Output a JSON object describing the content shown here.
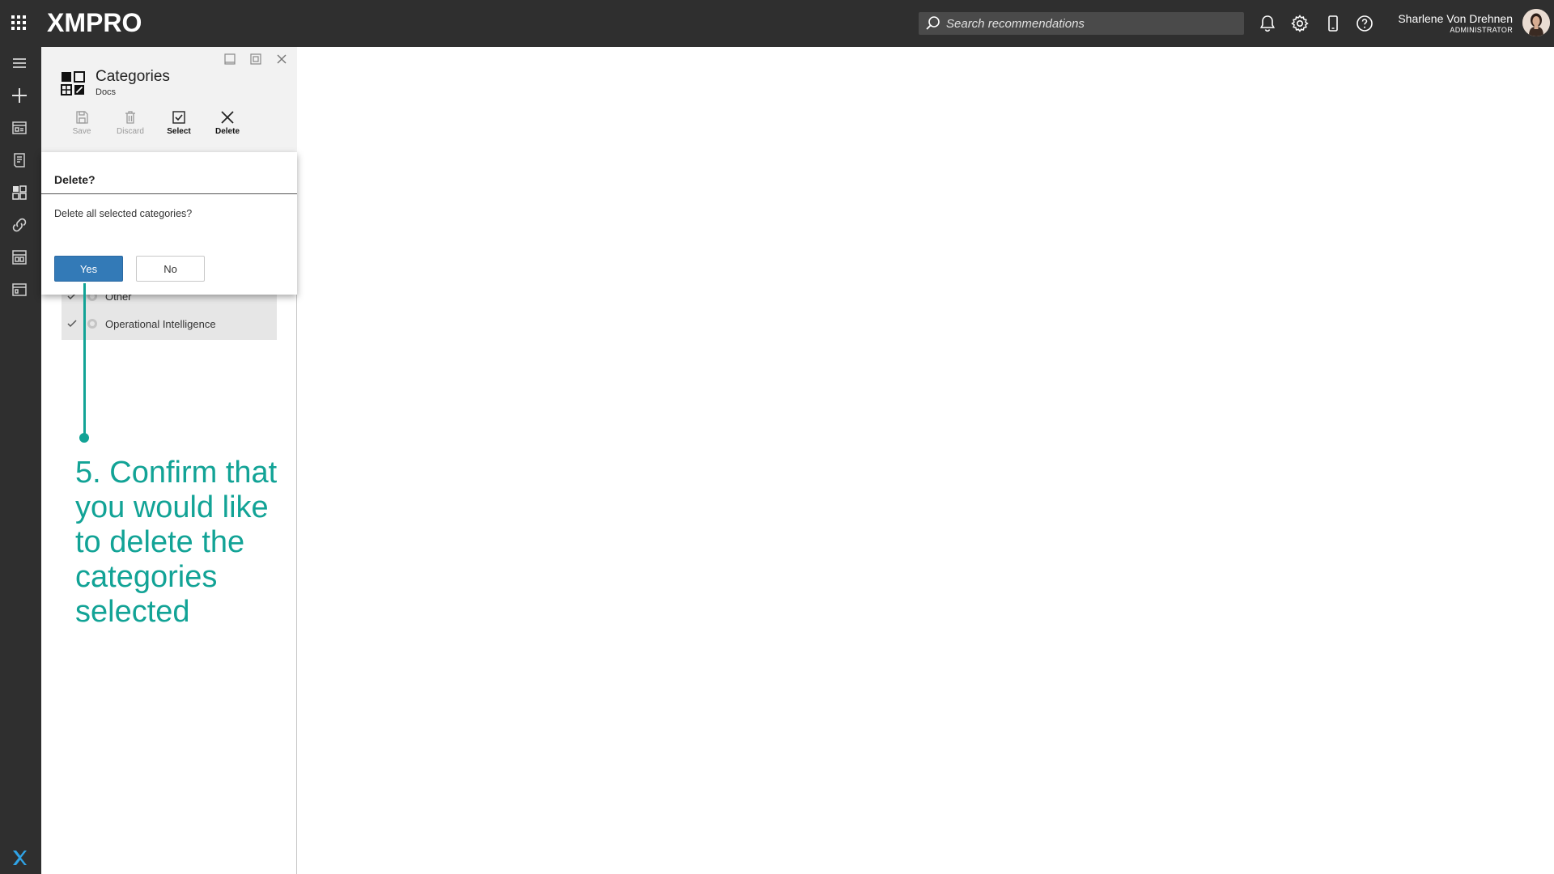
{
  "app": {
    "brand": "XMPRO",
    "search_placeholder": "Search recommendations"
  },
  "user": {
    "name": "Sharlene Von Drehnen",
    "role": "ADMINISTRATOR"
  },
  "panel": {
    "title": "Categories",
    "subtitle": "Docs",
    "toolbar": {
      "save": "Save",
      "discard": "Discard",
      "select": "Select",
      "delete": "Delete"
    }
  },
  "list": {
    "items": [
      {
        "label": "Other",
        "checked": true
      },
      {
        "label": "Operational Intelligence",
        "checked": true
      }
    ]
  },
  "dialog": {
    "title": "Delete?",
    "message": "Delete all selected categories?",
    "yes": "Yes",
    "no": "No"
  },
  "annotation": {
    "text": "5. Confirm that you would like to delete the categories selected"
  },
  "colors": {
    "topbar": "#2f2f2f",
    "accent": "#337ab7",
    "annotation": "#12a396"
  }
}
